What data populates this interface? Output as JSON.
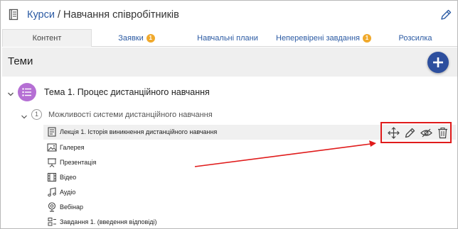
{
  "header": {
    "breadcrumb_link": "Курси",
    "separator": " / ",
    "page_title": "Навчання співробітників"
  },
  "tabs": [
    {
      "label": "Контент",
      "active": true,
      "badge": ""
    },
    {
      "label": "Заявки",
      "active": false,
      "badge": "1"
    },
    {
      "label": "Навчальні плани",
      "active": false,
      "badge": ""
    },
    {
      "label": "Неперевірені завдання",
      "active": false,
      "badge": "1"
    },
    {
      "label": "Розсилка",
      "active": false,
      "badge": ""
    }
  ],
  "topics": {
    "label": "Теми"
  },
  "topic": {
    "title": "Тема 1. Процес дистанційного навчання"
  },
  "section": {
    "number": "1",
    "title": "Можливості системи дистанційного навчання"
  },
  "items": [
    {
      "label": "Лекція 1. Історія виникнення дистанційного навчання",
      "icon": "document-icon"
    },
    {
      "label": "Галерея",
      "icon": "image-icon"
    },
    {
      "label": "Презентація",
      "icon": "presentation-icon"
    },
    {
      "label": "Відео",
      "icon": "video-icon"
    },
    {
      "label": "Аудіо",
      "icon": "music-icon"
    },
    {
      "label": "Вебінар",
      "icon": "webinar-icon"
    },
    {
      "label": "Завдання 1. (введення відповіді)",
      "icon": "task-icon"
    }
  ],
  "colors": {
    "link": "#2b5aa3",
    "badge": "#f0a92c",
    "add_button": "#2d4f9e",
    "topic_icon": "#b56fd4",
    "annotation": "#e01b1b"
  }
}
